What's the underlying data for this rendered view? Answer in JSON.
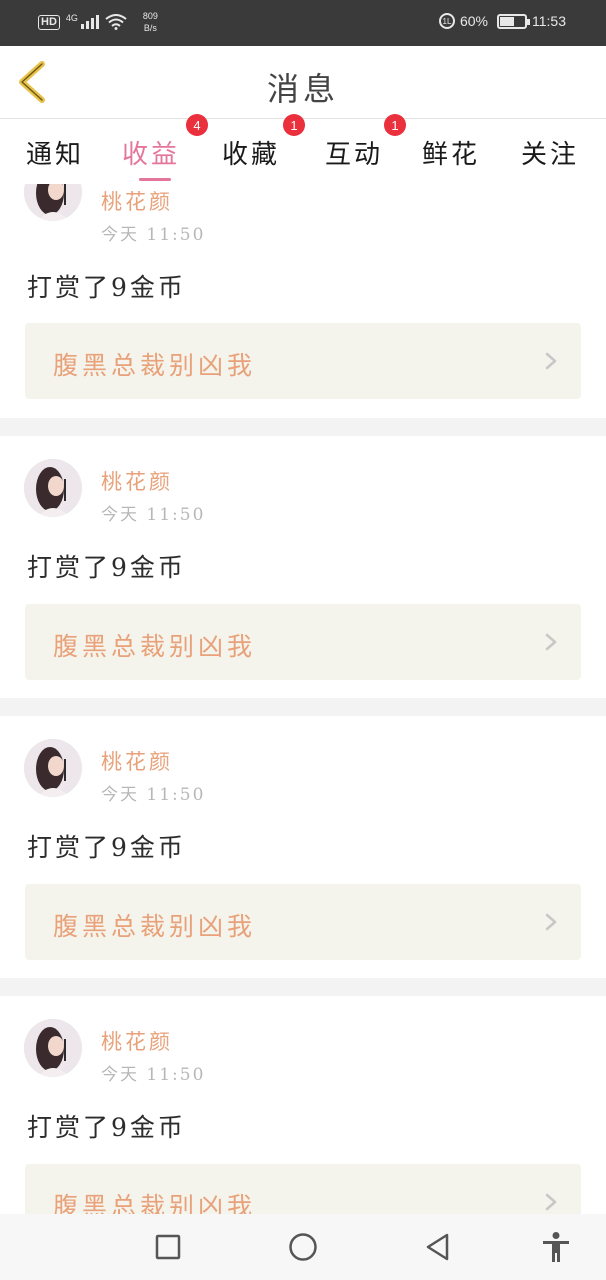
{
  "status_bar": {
    "hd": "HD",
    "network": "4G",
    "speed_value": "809",
    "speed_unit": "B/s",
    "alarm_label": "1L",
    "battery": "60%",
    "battery_level": 0.6,
    "time": "11:53"
  },
  "header": {
    "title": "消息",
    "back_icon": "chevron-left-icon"
  },
  "tabs": [
    {
      "label": "通知",
      "active": false,
      "badge": ""
    },
    {
      "label": "收益",
      "active": true,
      "badge": "4"
    },
    {
      "label": "收藏",
      "active": false,
      "badge": "1"
    },
    {
      "label": "互动",
      "active": false,
      "badge": "1"
    },
    {
      "label": "鲜花",
      "active": false,
      "badge": ""
    },
    {
      "label": "关注",
      "active": false,
      "badge": ""
    }
  ],
  "messages": [
    {
      "user": "桃花颜",
      "time": "今天 11:50",
      "action": "打赏了9金币",
      "book": "腹黑总裁别凶我"
    },
    {
      "user": "桃花颜",
      "time": "今天 11:50",
      "action": "打赏了9金币",
      "book": "腹黑总裁别凶我"
    },
    {
      "user": "桃花颜",
      "time": "今天 11:50",
      "action": "打赏了9金币",
      "book": "腹黑总裁别凶我"
    },
    {
      "user": "桃花颜",
      "time": "今天 11:50",
      "action": "打赏了9金币",
      "book": "腹黑总裁别凶我"
    }
  ],
  "colors": {
    "accent": "#e4769c",
    "badge": "#ea2f3d",
    "name": "#e8a179",
    "back_icon": "#e8c24a"
  },
  "nav": {
    "recent_icon": "square-icon",
    "home_icon": "circle-icon",
    "back_icon": "triangle-back-icon",
    "accessibility_icon": "accessibility-icon"
  }
}
